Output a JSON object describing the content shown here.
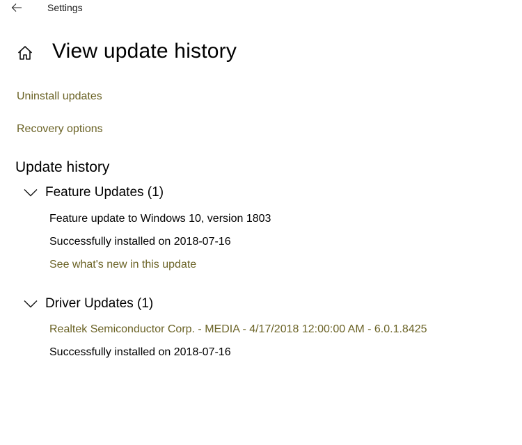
{
  "app": {
    "title": "Settings"
  },
  "icons": {
    "back": "back-arrow-icon",
    "home": "home-icon",
    "chevron": "chevron-down-icon"
  },
  "colors": {
    "link": "#6b6326",
    "text": "#000000",
    "background": "#ffffff"
  },
  "page": {
    "title": "View update history"
  },
  "links": {
    "uninstall": "Uninstall updates",
    "recovery": "Recovery options"
  },
  "history": {
    "title": "Update history",
    "groups": [
      {
        "label": "Feature Updates (1)",
        "entries": [
          {
            "name": "Feature update to Windows 10, version 1803",
            "status": "Successfully installed on 2018-07-16",
            "link": "See what's new in this update"
          }
        ]
      },
      {
        "label": "Driver Updates (1)",
        "entries": [
          {
            "name": "Realtek Semiconductor Corp. - MEDIA - 4/17/2018 12:00:00 AM - 6.0.1.8425",
            "status": "Successfully installed on 2018-07-16"
          }
        ]
      }
    ]
  }
}
